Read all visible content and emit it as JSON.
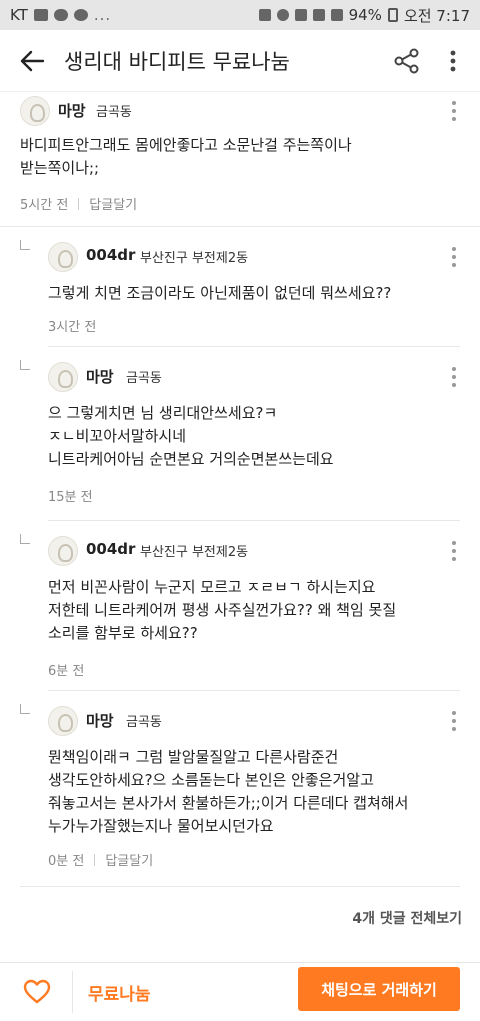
{
  "status_bar": {
    "carrier": "KT",
    "dots": "...",
    "battery": "94%",
    "time": "오전 7:17"
  },
  "app_bar": {
    "title": "생리대 바디피트 무료나눔",
    "back_icon": "arrow-left-icon",
    "share_icon": "share-icon",
    "more_icon": "more-vertical-icon"
  },
  "comments": [
    {
      "nickname": "마망",
      "location": "금곡동",
      "text": "바디피트안그래도 몸에안좋다고 소문난걸 주는쪽이나\n받는쪽이나;;",
      "time": "5시간 전",
      "reply_label": "답글달기",
      "is_reply": false
    },
    {
      "nickname": "004dr",
      "location": "부산진구 부전제2동",
      "text": "그렇게 치면 조금이라도 아닌제품이 없던데 뭐쓰세요??",
      "time": "3시간 전",
      "is_reply": true
    },
    {
      "nickname": "마망",
      "location": "금곡동",
      "text": "으 그렇게치면 님 생리대안쓰세요?ㅋ\nㅈㄴ비꼬아서말하시네\n니트라케어아님 순면본요 거의순면본쓰는데요",
      "time": "15분 전",
      "is_reply": true
    },
    {
      "nickname": "004dr",
      "location": "부산진구 부전제2동",
      "text": "먼저 비꼰사람이 누군지 모르고 ㅈㄹㅂㄱ 하시는지요\n저한테 니트라케어꺼 평생 사주실껀가요?? 왜 책임 못질\n소리를 함부로 하세요??",
      "time": "6분 전",
      "is_reply": true
    },
    {
      "nickname": "마망",
      "location": "금곡동",
      "text": "뭔책임이래ㅋ 그럼 발암물질알고 다른사람준건\n생각도안하세요?으 소름돋는다 본인은 안좋은거알고\n줘놓고서는 본사가서 환불하든가;;이거 다른데다 캡쳐해서\n누가누가잘했는지나 물어보시던가요",
      "time": "0분 전",
      "reply_label": "답글달기",
      "is_reply": true
    }
  ],
  "view_all": "4개 댓글 전체보기",
  "bottom_bar": {
    "heart_icon": "heart-outline-icon",
    "price": "무료나눔",
    "chat_button": "채팅으로 거래하기"
  },
  "colors": {
    "accent": "#ff7a20",
    "text": "#222222",
    "muted": "#888888"
  }
}
